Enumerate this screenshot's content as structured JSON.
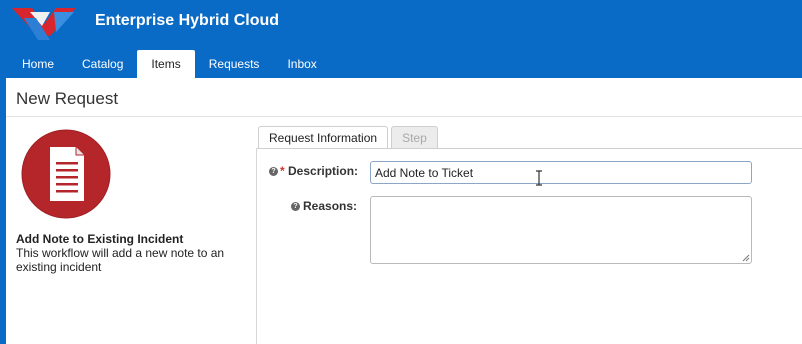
{
  "app": {
    "title": "Enterprise Hybrid Cloud"
  },
  "nav": {
    "tabs": [
      {
        "label": "Home"
      },
      {
        "label": "Catalog"
      },
      {
        "label": "Items"
      },
      {
        "label": "Requests"
      },
      {
        "label": "Inbox"
      }
    ],
    "active": "Items"
  },
  "page": {
    "title": "New Request"
  },
  "item": {
    "name": "Add Note to Existing Incident",
    "description": "This workflow will add a new note to an existing incident",
    "icon": "document-icon"
  },
  "form": {
    "tabs": [
      {
        "label": "Request Information"
      },
      {
        "label": "Step"
      }
    ],
    "description": {
      "required_mark": "*",
      "label": "Description:",
      "value": "Add Note to Ticket"
    },
    "reasons": {
      "label": "Reasons:",
      "value": ""
    },
    "help_glyph": "?"
  },
  "colors": {
    "header_blue": "#0a6bc6",
    "icon_red": "#b5262b",
    "required_red": "#d0342c"
  }
}
